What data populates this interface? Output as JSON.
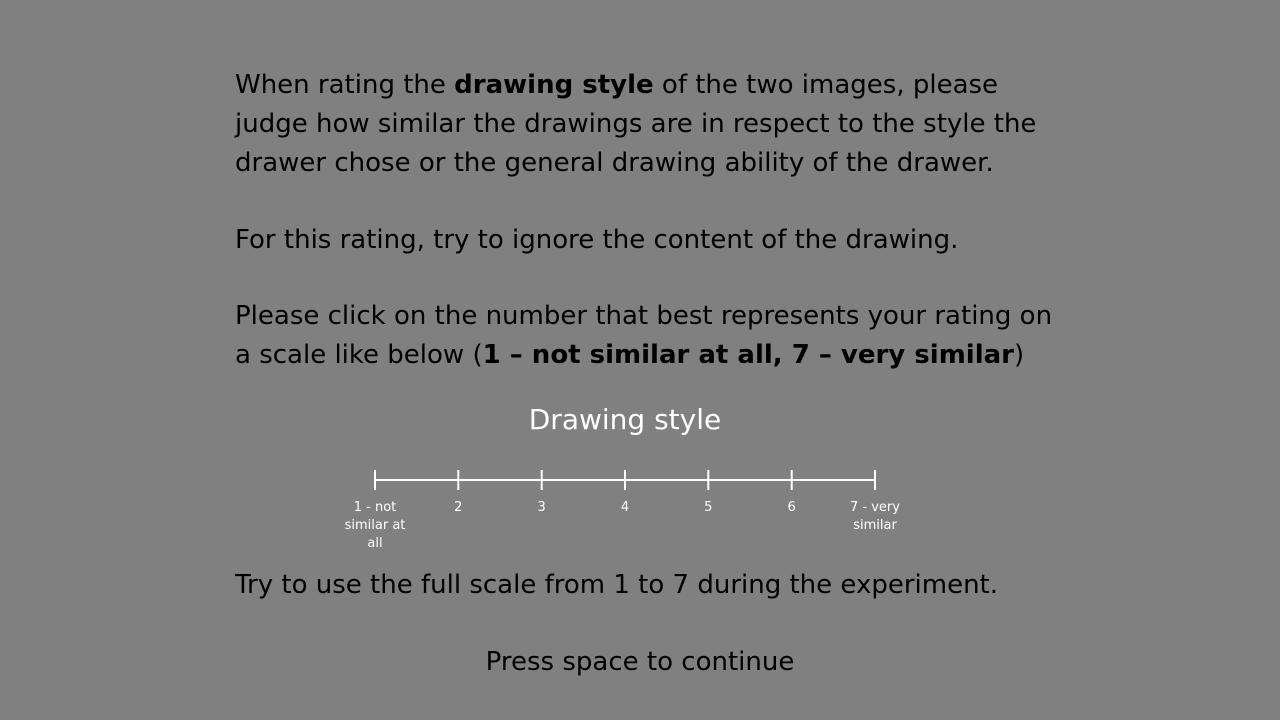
{
  "instructions": {
    "para1": {
      "line1_before": "When rating the ",
      "line1_bold": "drawing style",
      "line1_after": " of the two images, please",
      "line2": "judge how similar the drawings are in respect to the style the",
      "line3": "drawer chose or the general drawing ability of the drawer."
    },
    "para2": "For this rating, try to ignore the content of the drawing.",
    "para3": {
      "line1": "Please click on the number that best represents your rating on",
      "line2_before": "a scale like below  (",
      "line2_bold": "1 – not similar at all, 7 – very similar",
      "line2_after": ")"
    }
  },
  "scale": {
    "title": "Drawing style",
    "labels": [
      "1 - not similar at all",
      "2",
      "3",
      "4",
      "5",
      "6",
      "7 - very similar"
    ]
  },
  "footer": {
    "full_scale_note": "Try to use the full scale from 1 to 7 during the experiment.",
    "continue_prompt": "Press space to continue"
  }
}
